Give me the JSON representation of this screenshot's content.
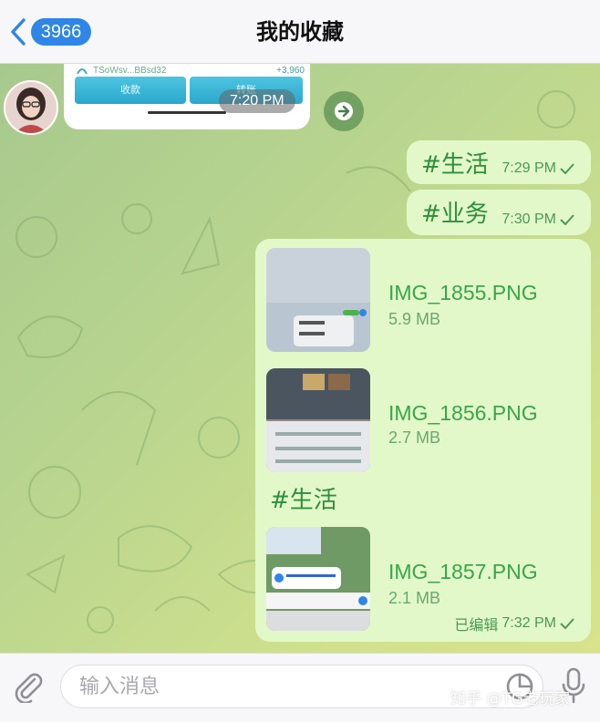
{
  "header": {
    "back_count": "3966",
    "title": "我的收藏"
  },
  "incoming": {
    "wallet_address": "TSoWsv...BBsd32",
    "wallet_amount": "+3,960",
    "btn_left": "收款",
    "btn_right": "转账",
    "time": "7:20 PM"
  },
  "messages": [
    {
      "text": "#生活",
      "time": "7:29 PM"
    },
    {
      "text": "#业务",
      "time": "7:30 PM"
    }
  ],
  "files": [
    {
      "name": "IMG_1855.PNG",
      "size": "5.9 MB"
    },
    {
      "name": "IMG_1856.PNG",
      "size": "2.7 MB"
    },
    {
      "name": "IMG_1857.PNG",
      "size": "2.1 MB"
    }
  ],
  "file_group": {
    "caption": "#生活",
    "edited_label": "已编辑",
    "time": "7:32 PM"
  },
  "input": {
    "placeholder": "输入消息"
  },
  "watermark": "知乎 @TG老玩家",
  "colors": {
    "accent": "#2f86e8",
    "outgoing_bubble": "#e3f8c9",
    "outgoing_text": "#2d8f3c"
  }
}
